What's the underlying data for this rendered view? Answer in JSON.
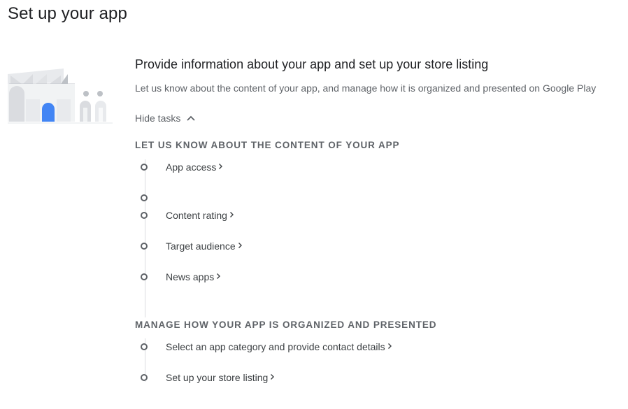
{
  "page": {
    "title": "Set up your app"
  },
  "section": {
    "heading": "Provide information about your app and set up your store listing",
    "description": "Let us know about the content of your app, and manage how it is organized and presented on Google Play",
    "hide_tasks_label": "Hide tasks"
  },
  "groups": [
    {
      "title": "LET US KNOW ABOUT THE CONTENT OF YOUR APP",
      "tasks": [
        {
          "label": "App access"
        },
        {
          "label": ""
        },
        {
          "label": "Content rating"
        },
        {
          "label": "Target audience"
        },
        {
          "label": "News apps"
        }
      ]
    },
    {
      "title": "MANAGE HOW YOUR APP IS ORGANIZED AND PRESENTED",
      "tasks": [
        {
          "label": "Select an app category and provide contact details"
        },
        {
          "label": "Set up your store listing"
        }
      ]
    }
  ],
  "icons": {
    "hide_tasks": "chevron-up-icon",
    "task_arrow": "chevron-right-icon",
    "task_status": "circle-outline-icon"
  },
  "colors": {
    "accent_blue": "#4285f4",
    "text_primary": "#202124",
    "text_secondary": "#5f6368",
    "divider": "#dadce0"
  }
}
